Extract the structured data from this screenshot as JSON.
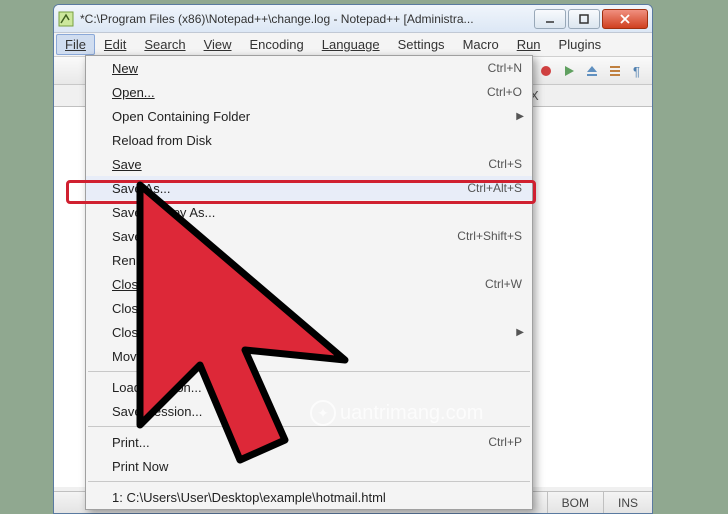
{
  "window": {
    "title": "*C:\\Program Files (x86)\\Notepad++\\change.log - Notepad++ [Administra..."
  },
  "menubar": {
    "file": "File",
    "edit": "Edit",
    "search": "Search",
    "view": "View",
    "encoding": "Encoding",
    "language": "Language",
    "settings": "Settings",
    "macro": "Macro",
    "run": "Run",
    "plugins": "Plugins"
  },
  "tabstrip": {
    "close": "X"
  },
  "file_menu": {
    "new": {
      "label": "New",
      "shortcut": "Ctrl+N"
    },
    "open": {
      "label": "Open...",
      "shortcut": "Ctrl+O"
    },
    "open_containing": {
      "label": "Open Containing Folder"
    },
    "reload": {
      "label": "Reload from Disk"
    },
    "save": {
      "label": "Save",
      "shortcut": "Ctrl+S"
    },
    "save_as": {
      "label": "Save As...",
      "shortcut": "Ctrl+Alt+S"
    },
    "save_copy": {
      "label": "Save a Copy As..."
    },
    "save_all": {
      "label": "Save All",
      "shortcut": "Ctrl+Shift+S"
    },
    "rename": {
      "label": "Rename..."
    },
    "close": {
      "label": "Close",
      "shortcut": "Ctrl+W"
    },
    "close_all": {
      "label": "Close All"
    },
    "close_more": {
      "label": "Close More"
    },
    "move_to": {
      "label": "Move to"
    },
    "load_session": {
      "label": "Load Session..."
    },
    "save_session": {
      "label": "Save Session..."
    },
    "print": {
      "label": "Print...",
      "shortcut": "Ctrl+P"
    },
    "print_now": {
      "label": "Print Now"
    },
    "recent1": {
      "label": "1: C:\\Users\\User\\Desktop\\example\\hotmail.html"
    }
  },
  "status": {
    "encoding": "BOM",
    "mode": "INS"
  },
  "watermark": "uantrimang.com"
}
